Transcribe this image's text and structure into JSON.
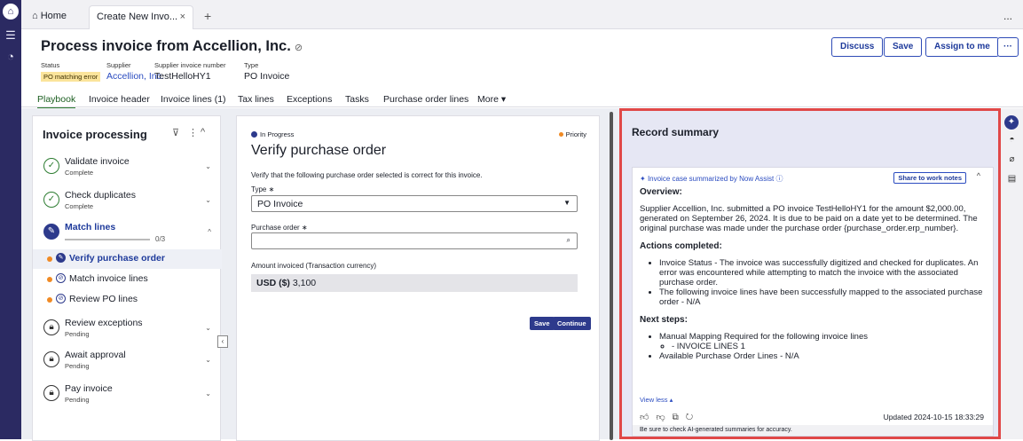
{
  "tabs": {
    "home": "Home",
    "active": "Create New Invo...",
    "close": "×",
    "plus": "+",
    "overflow": "..."
  },
  "header": {
    "title": "Process invoice from Accellion, Inc.",
    "labels": {
      "status": "Status",
      "supplier": "Supplier",
      "supplier_invoice_number": "Supplier invoice number",
      "type": "Type"
    },
    "values": {
      "status": "PO matching error",
      "supplier": "Accellion, Inc.",
      "supplier_invoice_number": "TestHelloHY1",
      "type": "PO Invoice"
    },
    "buttons": {
      "discuss": "Discuss",
      "save": "Save",
      "assign": "Assign to me",
      "more": "···"
    }
  },
  "page_tabs": [
    "Playbook",
    "Invoice header",
    "Invoice lines (1)",
    "Tax lines",
    "Exceptions",
    "Tasks",
    "Purchase order lines",
    "More ▾"
  ],
  "playbook": {
    "title": "Invoice processing",
    "steps": [
      {
        "title": "Validate invoice",
        "status": "Complete"
      },
      {
        "title": "Check duplicates",
        "status": "Complete"
      },
      {
        "title": "Match lines",
        "progress": "0/3"
      },
      {
        "title": "Review exceptions",
        "status": "Pending"
      },
      {
        "title": "Await approval",
        "status": "Pending"
      },
      {
        "title": "Pay invoice",
        "status": "Pending"
      }
    ],
    "substeps": [
      "Verify purchase order",
      "Match invoice lines",
      "Review PO lines"
    ]
  },
  "task": {
    "state": "In Progress",
    "priority": "Priority",
    "title": "Verify purchase order",
    "description": "Verify that the following purchase order selected is correct for this invoice.",
    "type_label": "Type ∗",
    "type_value": "PO Invoice",
    "po_label": "Purchase order ∗",
    "po_value": "",
    "amount_label": "Amount invoiced (Transaction currency)",
    "amount_currency": "USD ($)",
    "amount_value": "3,100",
    "save": "Save",
    "continue": "Continue"
  },
  "summary": {
    "panel_title": "Record summary",
    "source": "Invoice case summarized by Now Assist",
    "share": "Share to work notes",
    "overview_h": "Overview:",
    "overview": "Supplier Accellion, Inc. submitted a PO invoice TestHelloHY1 for the amount $2,000.00, generated on September 26, 2024. It is due to be paid on a date yet to be determined. The original purchase was made under the purchase order {purchase_order.erp_number}.",
    "actions_h": "Actions completed:",
    "actions": [
      "Invoice Status - The invoice was successfully digitized and checked for duplicates. An error was encountered while attempting to match the invoice with the associated purchase order.",
      "The following invoice lines have been successfully mapped to the associated purchase order - N/A"
    ],
    "next_h": "Next steps:",
    "next_1": "Manual Mapping Required for the following invoice lines",
    "next_1_sub": "- INVOICE LINES 1",
    "next_2": "Available Purchase Order Lines - N/A",
    "view_less": "View less ▴",
    "updated": "Updated 2024-10-15 18:33:29",
    "disclaimer": "Be sure to check AI-generated summaries for accuracy."
  },
  "colors": {
    "rail": "#2b2a62",
    "accent": "#2d3a8c",
    "highlight": "#e04848",
    "warning_badge": "#fbe49b",
    "success": "#2e7d32"
  }
}
